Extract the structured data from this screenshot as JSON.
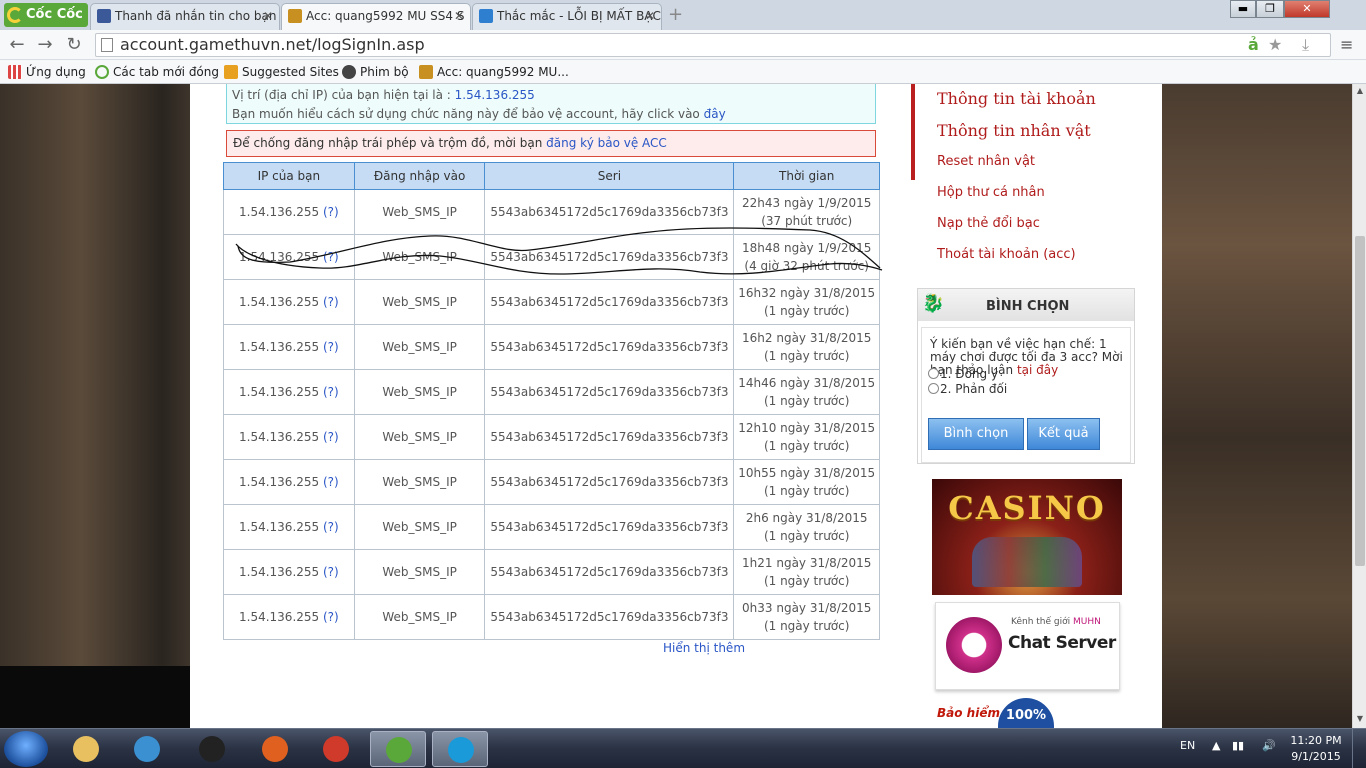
{
  "browser": {
    "brand": "Cốc Cốc",
    "tabs": [
      {
        "title": "Thanh đã nhắn tin cho bạn",
        "favicon_color": "#3b5998"
      },
      {
        "title": "Acc: quang5992 MU SS4 S",
        "favicon_color": "#c89020"
      },
      {
        "title": "Thắc mắc - LỖI BỊ MẤT BẠC",
        "favicon_color": "#2f7fd0"
      }
    ],
    "address": "account.gamethuvn.net/logSignIn.asp",
    "bookmarks": [
      {
        "label": "Ứng dụng",
        "color": "#d44"
      },
      {
        "label": "Các tab mới đóng",
        "color": "#5aa83a"
      },
      {
        "label": "Suggested Sites",
        "color": "#e8a020"
      },
      {
        "label": "Phim bộ",
        "color": "#444"
      },
      {
        "label": "Acc: quang5992 MU...",
        "color": "#c89020"
      }
    ]
  },
  "info": {
    "ip_text": "Vị trí (địa chỉ IP) của bạn hiện tại là : ",
    "ip_value": "1.54.136.255",
    "help_text": "Bạn muốn hiểu cách sử dụng chức năng này để bảo vệ account, hãy click vào ",
    "help_link": "đây"
  },
  "warning": {
    "text": "Để chống đăng nhập trái phép và trộm đồ, mời bạn ",
    "link": "đăng ký bảo vệ ACC"
  },
  "log_table": {
    "headers": [
      "IP của bạn",
      "Đăng nhập vào",
      "Seri",
      "Thời gian"
    ],
    "rows": [
      {
        "ip": "1.54.136.255",
        "q": "(?)",
        "target": "Web_SMS_IP",
        "seri": "5543ab6345172d5c1769da3356cb73f3",
        "time": "22h43 ngày 1/9/2015",
        "ago": "(37 phút trước)"
      },
      {
        "ip": "1.54.136.255",
        "q": "(?)",
        "target": "Web_SMS_IP",
        "seri": "5543ab6345172d5c1769da3356cb73f3",
        "time": "18h48 ngày 1/9/2015",
        "ago": "(4 giờ 32 phút trước)"
      },
      {
        "ip": "1.54.136.255",
        "q": "(?)",
        "target": "Web_SMS_IP",
        "seri": "5543ab6345172d5c1769da3356cb73f3",
        "time": "16h32 ngày 31/8/2015",
        "ago": "(1 ngày trước)"
      },
      {
        "ip": "1.54.136.255",
        "q": "(?)",
        "target": "Web_SMS_IP",
        "seri": "5543ab6345172d5c1769da3356cb73f3",
        "time": "16h2 ngày 31/8/2015",
        "ago": "(1 ngày trước)"
      },
      {
        "ip": "1.54.136.255",
        "q": "(?)",
        "target": "Web_SMS_IP",
        "seri": "5543ab6345172d5c1769da3356cb73f3",
        "time": "14h46 ngày 31/8/2015",
        "ago": "(1 ngày trước)"
      },
      {
        "ip": "1.54.136.255",
        "q": "(?)",
        "target": "Web_SMS_IP",
        "seri": "5543ab6345172d5c1769da3356cb73f3",
        "time": "12h10 ngày 31/8/2015",
        "ago": "(1 ngày trước)"
      },
      {
        "ip": "1.54.136.255",
        "q": "(?)",
        "target": "Web_SMS_IP",
        "seri": "5543ab6345172d5c1769da3356cb73f3",
        "time": "10h55 ngày 31/8/2015",
        "ago": "(1 ngày trước)"
      },
      {
        "ip": "1.54.136.255",
        "q": "(?)",
        "target": "Web_SMS_IP",
        "seri": "5543ab6345172d5c1769da3356cb73f3",
        "time": "2h6 ngày 31/8/2015",
        "ago": "(1 ngày trước)"
      },
      {
        "ip": "1.54.136.255",
        "q": "(?)",
        "target": "Web_SMS_IP",
        "seri": "5543ab6345172d5c1769da3356cb73f3",
        "time": "1h21 ngày 31/8/2015",
        "ago": "(1 ngày trước)"
      },
      {
        "ip": "1.54.136.255",
        "q": "(?)",
        "target": "Web_SMS_IP",
        "seri": "5543ab6345172d5c1769da3356cb73f3",
        "time": "0h33 ngày 31/8/2015",
        "ago": "(1 ngày trước)"
      }
    ],
    "more": "Hiển thị thêm"
  },
  "sidebar": {
    "links": [
      "Thông tin tài khoản",
      "Thông tin nhân vật",
      "Reset nhân vật",
      "Hộp thư cá nhân",
      "Nạp thẻ đổi bạc",
      "Thoát tài khoản (acc)"
    ],
    "vote": {
      "title": "BÌNH CHỌN",
      "question": "Ý kiến bạn về việc hạn chế: 1 máy chơi được tối đa 3 acc? Mời bạn thảo luận ",
      "question_link": "tại đây",
      "options": [
        "1. Đồng ý",
        "2. Phản đối"
      ],
      "vote_button": "Bình chọn",
      "result_button": "Kết quả"
    },
    "casino_text": "CASINO",
    "chat": {
      "kenh": "Kênh thế giới ",
      "kenh_brand": "MUHN",
      "name": "Chat Server"
    },
    "insurance": {
      "text": "Bảo hiểm đồ",
      "badge": "100%"
    }
  },
  "taskbar": {
    "lang": "EN",
    "time": "11:20 PM",
    "date": "9/1/2015",
    "apps": [
      {
        "name": "explorer",
        "color": "#e8c060",
        "active": false
      },
      {
        "name": "media",
        "color": "#3a90d0",
        "active": false
      },
      {
        "name": "mu",
        "color": "#222",
        "active": false
      },
      {
        "name": "firefox",
        "color": "#e06020",
        "active": false
      },
      {
        "name": "chrome",
        "color": "#d03a2a",
        "active": false
      },
      {
        "name": "coccoc",
        "color": "#5aa83a",
        "active": true
      },
      {
        "name": "skype",
        "color": "#1a9ad8",
        "active": true
      }
    ]
  }
}
